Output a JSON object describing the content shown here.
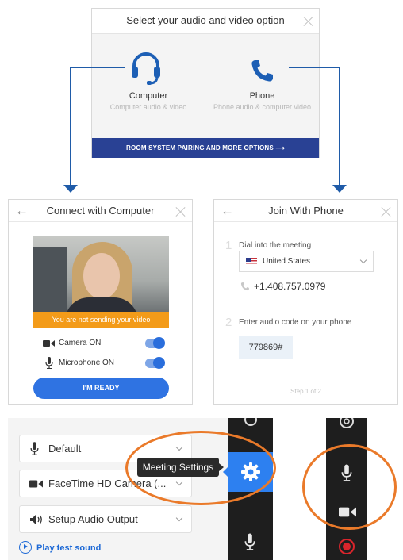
{
  "top_dialog": {
    "title": "Select your audio and video option",
    "computer": {
      "label": "Computer",
      "sub": "Computer audio & video",
      "icon": "headset-icon"
    },
    "phone": {
      "label": "Phone",
      "sub": "Phone audio & computer video",
      "icon": "phone-icon"
    },
    "more_options": "ROOM SYSTEM PAIRING AND MORE OPTIONS ⟶"
  },
  "computer_dialog": {
    "title": "Connect with Computer",
    "video_banner": "You are not sending your video",
    "camera_label": "Camera ON",
    "mic_label": "Microphone ON",
    "ready_button": "I'M READY"
  },
  "phone_dialog": {
    "title": "Join With Phone",
    "step1_num": "1",
    "step1_text": "Dial into the meeting",
    "country": "United States",
    "phone_number": "+1.408.757.0979",
    "step2_num": "2",
    "step2_text": "Enter audio code on your phone",
    "audio_code": "779869#",
    "step_indicator": "Step 1 of 2"
  },
  "settings": {
    "mic_device": "Default",
    "camera_device": "FaceTime HD Camera (...",
    "audio_output": "Setup Audio Output",
    "play_test": "Play test sound",
    "tooltip": "Meeting Settings"
  },
  "colors": {
    "accent": "#1f5ba8",
    "orange": "#ea7a2a",
    "orange_banner": "#f39b19",
    "blue_button": "#2f73e2",
    "sidebar": "#1e1e1e"
  }
}
